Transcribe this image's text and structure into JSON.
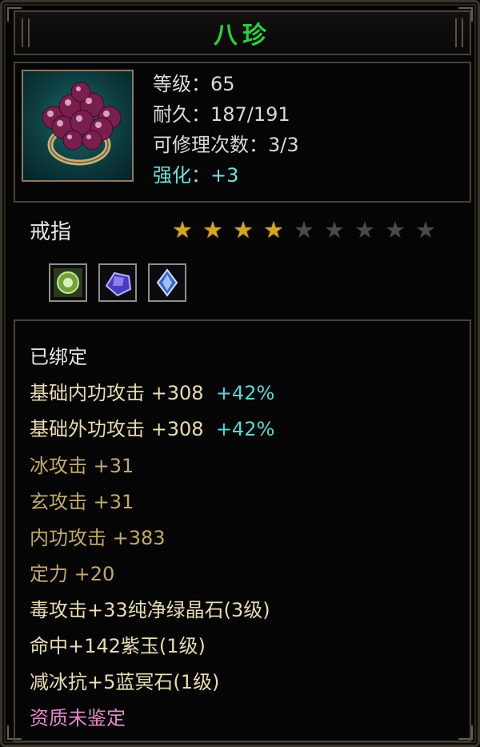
{
  "item": {
    "name": "八珍",
    "icon": "grape-ring-icon",
    "stats": {
      "level": "等级：65",
      "durability": "耐久：187/191",
      "repairs": "可修理次数：3/3",
      "enhance": "强化：+3"
    },
    "type": "戒指",
    "stars_total": 9,
    "stars_filled": 4,
    "gem_slots": [
      "green-gem-icon",
      "purple-gem-icon",
      "blue-crystal-icon"
    ],
    "bound": "已绑定",
    "attributes": [
      {
        "text": "基础内功攻击  +308",
        "extra": "+42%"
      },
      {
        "text": "基础外功攻击  +308",
        "extra": "+42%"
      },
      {
        "text": "冰攻击  +31"
      },
      {
        "text": "玄攻击  +31"
      },
      {
        "text": "内功攻击  +383"
      },
      {
        "text": "定力  +20"
      }
    ],
    "socketed": [
      "毒攻击+33纯净绿晶石(3级)",
      "命中+142紫玉(1级)",
      "减冰抗+5蓝冥石(1级)"
    ],
    "quality": "资质未鉴定"
  },
  "colors": {
    "title": "#27d13a",
    "enhance": "#6fe0e0",
    "percent": "#56d8d8",
    "quality": "#e089c8",
    "star_on": "#d4a520",
    "star_off": "#4a4a4a"
  }
}
